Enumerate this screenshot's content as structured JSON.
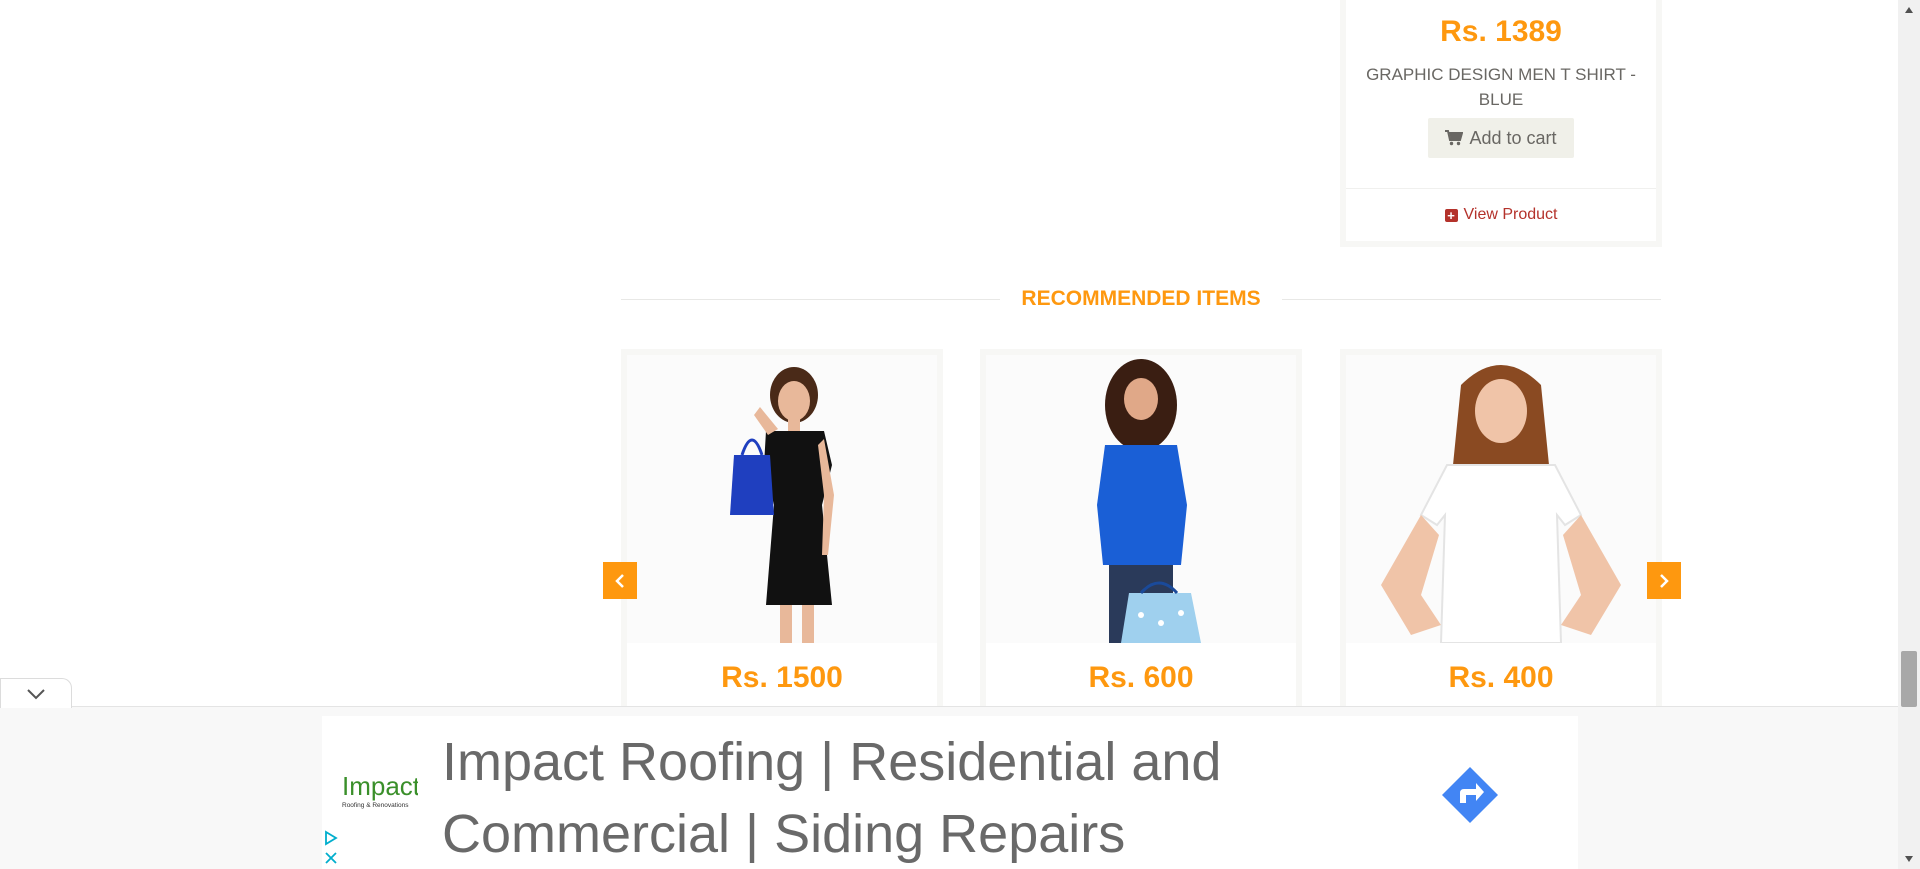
{
  "top_product": {
    "price": "Rs. 1389",
    "title": "GRAPHIC DESIGN MEN T SHIRT - BLUE",
    "add_to_cart": "Add to cart",
    "view_product": "View Product"
  },
  "recommended": {
    "title": "RECOMMENDED ITEMS",
    "items": [
      {
        "price": "Rs. 1500",
        "image": "woman-black-dress-shopping-bag"
      },
      {
        "price": "Rs. 600",
        "image": "woman-blue-top-shopping-bag"
      },
      {
        "price": "Rs. 400",
        "image": "girl-white-tshirt"
      }
    ]
  },
  "ad": {
    "headline": "Impact Roofing | Residential and Commercial | Siding Repairs",
    "logo_text": "Impact",
    "logo_subtext": "Roofing & Renovations"
  },
  "colors": {
    "accent": "#fe980f",
    "link": "#b4322b",
    "text": "#696763"
  },
  "icons": {
    "cart": "shopping-cart-icon",
    "plus": "plus-square-icon",
    "prev": "chevron-left-icon",
    "next": "chevron-right-icon",
    "collapse": "chevron-down-icon",
    "cta": "directions-arrow-icon",
    "adchoices": "adchoices-icon",
    "close": "close-icon"
  }
}
